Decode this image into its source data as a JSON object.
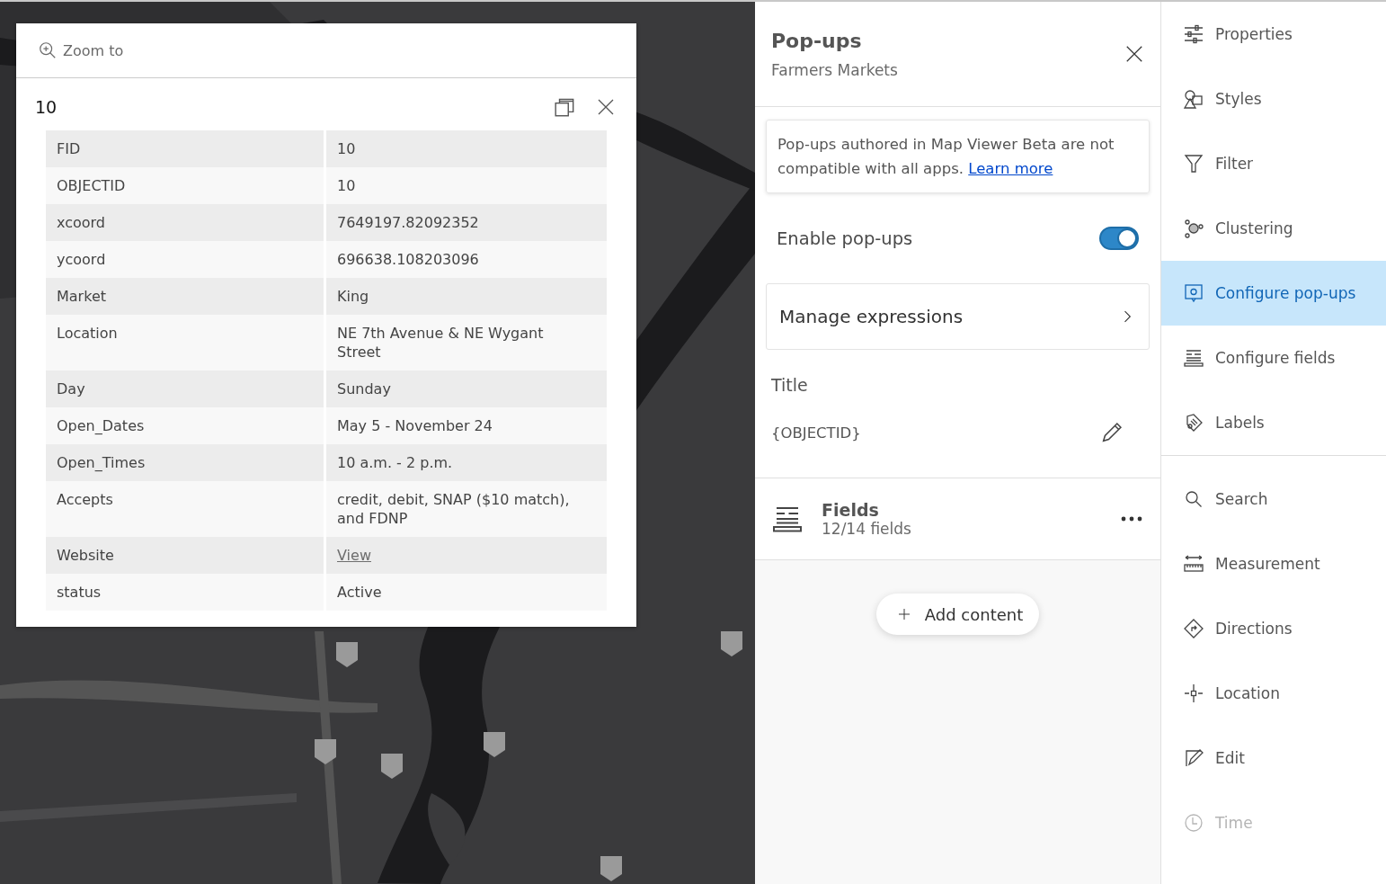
{
  "map": {
    "kind": "picture"
  },
  "popup": {
    "zoom_action": "Zoom to",
    "title": "10",
    "rows": [
      {
        "field": "FID",
        "value": "10",
        "kind": "text"
      },
      {
        "field": "OBJECTID",
        "value": "10",
        "kind": "text"
      },
      {
        "field": "xcoord",
        "value": "7649197.82092352",
        "kind": "text"
      },
      {
        "field": "ycoord",
        "value": "696638.108203096",
        "kind": "text"
      },
      {
        "field": "Market",
        "value": "King",
        "kind": "text"
      },
      {
        "field": "Location",
        "value": "NE 7th Avenue & NE Wygant Street",
        "kind": "text"
      },
      {
        "field": "Day",
        "value": "Sunday",
        "kind": "text"
      },
      {
        "field": "Open_Dates",
        "value": "May 5 - November 24",
        "kind": "text"
      },
      {
        "field": "Open_Times",
        "value": "10 a.m. - 2 p.m.",
        "kind": "text"
      },
      {
        "field": "Accepts",
        "value": "credit, debit, SNAP ($10 match), and FDNP",
        "kind": "text"
      },
      {
        "field": "Website",
        "value": "View",
        "kind": "link"
      },
      {
        "field": "status",
        "value": "Active",
        "kind": "text"
      }
    ]
  },
  "panel": {
    "title": "Pop-ups",
    "subtitle": "Farmers Markets",
    "notice": {
      "text": "Pop-ups authored in Map Viewer Beta are not compatible with all apps.",
      "link": "Learn more"
    },
    "enable": {
      "label": "Enable pop-ups",
      "on": true
    },
    "manage": "Manage expressions",
    "title_section": {
      "label": "Title",
      "value": "{OBJECTID}"
    },
    "fields": {
      "title": "Fields",
      "count": "12/14 fields"
    },
    "add_button": "Add content"
  },
  "tool_groups": [
    [
      {
        "label": "Properties",
        "kind": "sliders",
        "selected": false,
        "disabled": false
      },
      {
        "label": "Styles",
        "kind": "shapes",
        "selected": false,
        "disabled": false
      },
      {
        "label": "Filter",
        "kind": "funnel",
        "selected": false,
        "disabled": false
      },
      {
        "label": "Clustering",
        "kind": "cluster",
        "selected": false,
        "disabled": false
      },
      {
        "label": "Configure pop-ups",
        "kind": "popup",
        "selected": true,
        "disabled": false
      },
      {
        "label": "Configure fields",
        "kind": "fields",
        "selected": false,
        "disabled": false
      },
      {
        "label": "Labels",
        "kind": "tag",
        "selected": false,
        "disabled": false
      }
    ],
    [
      {
        "label": "Search",
        "kind": "search",
        "selected": false,
        "disabled": false
      },
      {
        "label": "Measurement",
        "kind": "ruler",
        "selected": false,
        "disabled": false
      },
      {
        "label": "Directions",
        "kind": "directions",
        "selected": false,
        "disabled": false
      },
      {
        "label": "Location",
        "kind": "crosshair",
        "selected": false,
        "disabled": false
      },
      {
        "label": "Edit",
        "kind": "edit",
        "selected": false,
        "disabled": false
      },
      {
        "label": "Time",
        "kind": "clock",
        "selected": false,
        "disabled": true
      }
    ]
  ]
}
